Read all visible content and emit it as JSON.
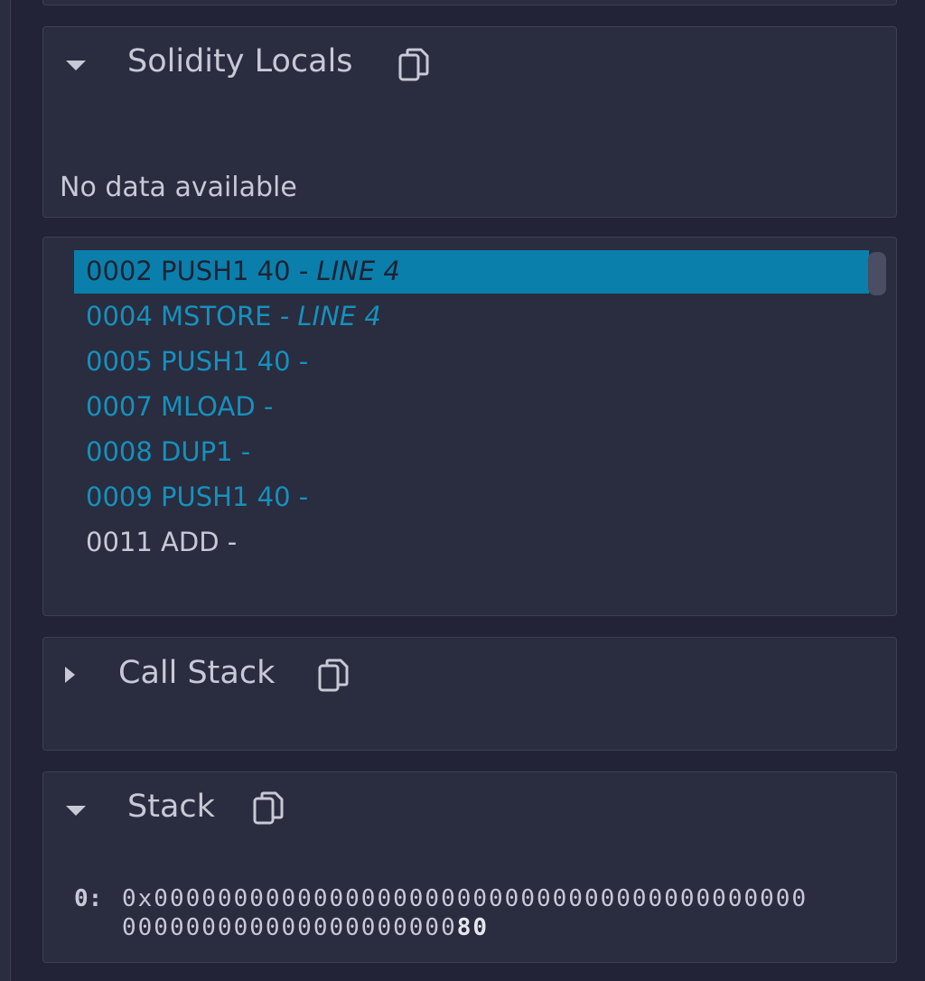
{
  "solidity_locals": {
    "title": "Solidity Locals",
    "expanded": true,
    "icon": "copy-icon",
    "empty_text": "No data available"
  },
  "opcodes": {
    "items": [
      {
        "text": "0002 PUSH1 40 ",
        "line": "- LINE 4",
        "state": "selected"
      },
      {
        "text": "0004 MSTORE ",
        "line": "- LINE 4",
        "state": "reached"
      },
      {
        "text": "0005 PUSH1 40 -",
        "line": "",
        "state": "reached"
      },
      {
        "text": "0007 MLOAD -",
        "line": "",
        "state": "reached"
      },
      {
        "text": "0008 DUP1 -",
        "line": "",
        "state": "reached"
      },
      {
        "text": "0009 PUSH1 40 -",
        "line": "",
        "state": "reached"
      },
      {
        "text": "0011 ADD -",
        "line": "",
        "state": "pending"
      }
    ],
    "colors": {
      "selected_bg": "#0a7fab",
      "reached": "#1591bd",
      "pending": "#c7c9d6"
    }
  },
  "call_stack": {
    "title": "Call Stack",
    "expanded": false,
    "icon": "copy-icon"
  },
  "stack": {
    "title": "Stack",
    "expanded": true,
    "icon": "copy-icon",
    "entries": [
      {
        "index": "0:",
        "value_prefix": "0x00000000000000000000000000000000000000000000000000000000000000",
        "value_suffix": "80"
      }
    ]
  }
}
